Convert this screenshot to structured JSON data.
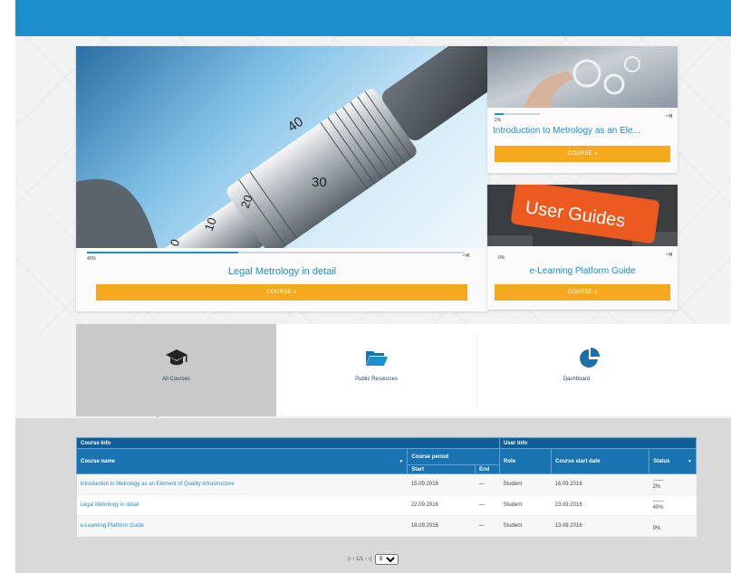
{
  "colors": {
    "accent": "#1d8fcf",
    "button": "#f6a821",
    "header_dark": "#0f5e95",
    "header": "#1873b0"
  },
  "featured": {
    "progress_fraction": 0.4,
    "progress_label": "40%",
    "title": "Legal Metrology in detail",
    "button_label": "COURSE »",
    "image_numbers": [
      "40",
      "30",
      "20",
      "10",
      "0"
    ]
  },
  "side_courses": [
    {
      "title": "Introduction to Metrology as an Ele...",
      "progress_fraction": 0.2,
      "progress_label": "2%",
      "button_label": "COURSE »"
    },
    {
      "title": "e-Learning Platform Guide",
      "progress_fraction": 0.0,
      "progress_label": "0%",
      "button_label": "COURSE »",
      "image_text": "User Guides"
    }
  ],
  "tiles": [
    {
      "label": "All Courses",
      "icon": "graduation-cap-icon"
    },
    {
      "label": "Public Resources",
      "icon": "folder-open-icon"
    },
    {
      "label": "Dashboard",
      "icon": "pie-chart-icon"
    }
  ],
  "table": {
    "group_course_info": "Course Info",
    "group_user_info": "User Info",
    "col_course_name": "Course name",
    "col_course_period": "Course period",
    "col_start": "Start",
    "col_end": "End",
    "col_role": "Role",
    "col_course_start_date": "Course start date",
    "col_status": "Status",
    "rows": [
      {
        "name": "Introduction to Metrology as an Element of Quality Infrastructure",
        "start": "15.09.2016",
        "end": "—",
        "role": "Student",
        "course_start_date": "16.09.2016",
        "status": "2%"
      },
      {
        "name": "Legal Metrology in detail",
        "start": "22.09.2016",
        "end": "—",
        "role": "Student",
        "course_start_date": "23.09.2016",
        "status": "40%"
      },
      {
        "name": "e-Learning Platform Guide",
        "start": "18.09.2016",
        "end": "—",
        "role": "Student",
        "course_start_date": "13.09.2016",
        "status": "0%"
      }
    ]
  },
  "pager": {
    "text": "|‹ ‹ 1/1 › ›|",
    "page_size": "5"
  }
}
